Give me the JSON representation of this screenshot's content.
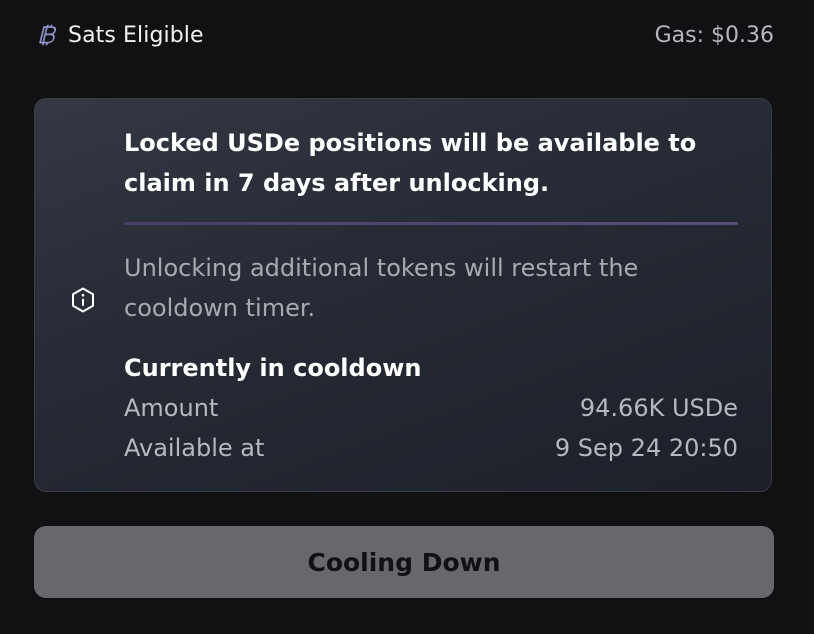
{
  "header": {
    "sats_label": "Sats Eligible",
    "gas_text": "Gas: $0.36",
    "sats_icon": "bitcoin-icon"
  },
  "card": {
    "headline": "Locked USDe positions will be available to claim in 7 days after unlocking.",
    "note": "Unlocking additional tokens will restart the cooldown timer.",
    "cooldown_title": "Currently in cooldown",
    "rows": [
      {
        "label": "Amount",
        "value": "94.66K USDe"
      },
      {
        "label": "Available at",
        "value": "9 Sep 24 20:50"
      }
    ],
    "info_icon": "info-hexagon-icon"
  },
  "cta": {
    "label": "Cooling Down"
  },
  "colors": {
    "background": "#111114",
    "card_border": "#3a3d49",
    "divider": "#4f4473",
    "button": "#67686d"
  }
}
